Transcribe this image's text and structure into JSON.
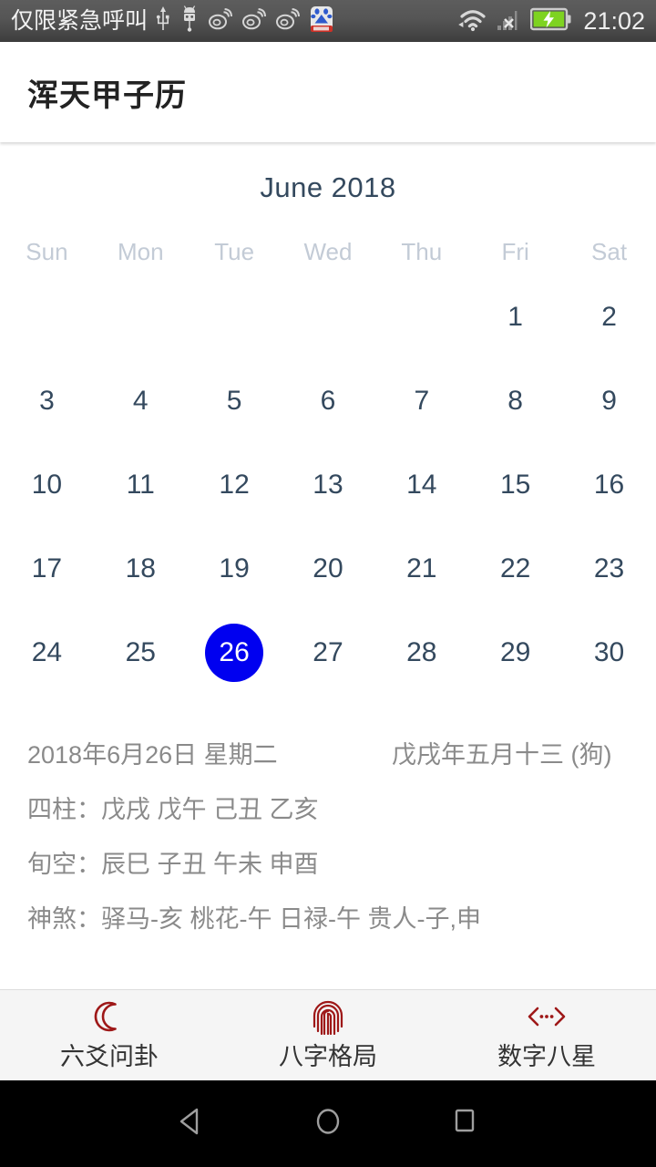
{
  "status_bar": {
    "carrier": "仅限紧急呼叫",
    "time": "21:02",
    "left_icons": [
      "usb-icon",
      "android-debug-icon",
      "weibo-icon",
      "weibo-icon",
      "weibo-icon",
      "baidu-icon"
    ],
    "right_icons": [
      "wifi-icon",
      "no-sim-signal-icon",
      "battery-charging-icon"
    ],
    "background": "#555555",
    "text_color": "#f2f2f2"
  },
  "app_bar": {
    "title": "浑天甲子历",
    "background": "#ffffff",
    "title_color": "#222222"
  },
  "calendar": {
    "month_label": "June 2018",
    "month_color": "#34495e",
    "weekday_color": "#c3cbd6",
    "day_color": "#34495e",
    "selected_bg": "#0000f0",
    "selected_text": "#ffffff",
    "weekdays": [
      "Sun",
      "Mon",
      "Tue",
      "Wed",
      "Thu",
      "Fri",
      "Sat"
    ],
    "selected_day": 26,
    "weeks": [
      [
        "",
        "",
        "",
        "",
        "",
        "1",
        "2"
      ],
      [
        "3",
        "4",
        "5",
        "6",
        "7",
        "8",
        "9"
      ],
      [
        "10",
        "11",
        "12",
        "13",
        "14",
        "15",
        "16"
      ],
      [
        "17",
        "18",
        "19",
        "20",
        "21",
        "22",
        "23"
      ],
      [
        "24",
        "25",
        "26",
        "27",
        "28",
        "29",
        "30"
      ]
    ]
  },
  "info": {
    "text_color": "#8a8a8a",
    "gregorian_date": "2018年6月26日 星期二",
    "lunar_date": "戊戌年五月十三 (狗)",
    "four_pillars": "四柱：戊戌 戊午 己丑 乙亥",
    "xunkong": "旬空：辰巳 子丑 午未 申酉",
    "shensha": "神煞：驿马-亥 桃花-午 日禄-午 贵人-子,申"
  },
  "tab_bar": {
    "background": "#f5f5f5",
    "icon_color": "#9e1818",
    "label_color": "#333333",
    "tabs": [
      {
        "label": "六爻问卦",
        "icon": "crescent-moon-icon"
      },
      {
        "label": "八字格局",
        "icon": "fingerprint-icon"
      },
      {
        "label": "数字八星",
        "icon": "code-brackets-icon"
      }
    ]
  },
  "nav_bar": {
    "background": "#000000",
    "icon_color": "#9e9e9e",
    "buttons": [
      "back-icon",
      "home-icon",
      "recents-icon"
    ]
  }
}
